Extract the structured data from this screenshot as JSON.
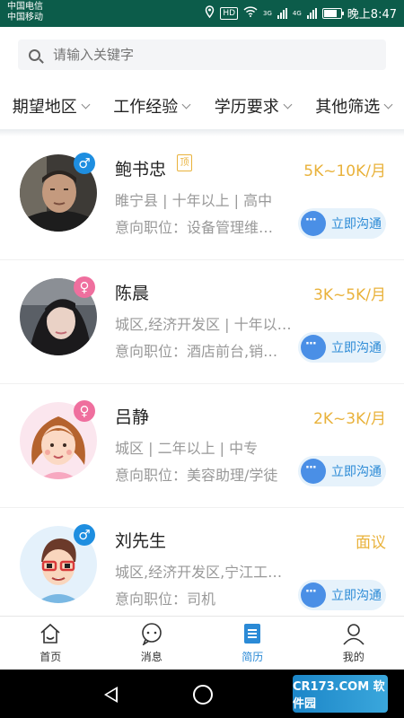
{
  "status_bar": {
    "carrier_1": "中国电信",
    "carrier_2": "中国移动",
    "time": "晚上8:47",
    "hd": "HD",
    "net_1": "3G",
    "net_2": "4G"
  },
  "search": {
    "placeholder": "请输入关键字"
  },
  "filters": [
    {
      "label": "期望地区"
    },
    {
      "label": "工作经验"
    },
    {
      "label": "学历要求"
    },
    {
      "label": "其他筛选"
    }
  ],
  "candidates": [
    {
      "name": "鲍书忠",
      "gender": "male",
      "gender_symbol": "♂",
      "top_badge": "顶",
      "salary": "5K~10K/月",
      "info": "睢宁县 | 十年以上 | 高中",
      "intent": "意向职位：设备管理维…",
      "chat_label": "立即沟通"
    },
    {
      "name": "陈晨",
      "gender": "female",
      "gender_symbol": "♀",
      "top_badge": "",
      "salary": "3K~5K/月",
      "info": "城区,经济开发区 | 十年以…",
      "intent": "意向职位：酒店前台,销…",
      "chat_label": "立即沟通"
    },
    {
      "name": "吕静",
      "gender": "female",
      "gender_symbol": "♀",
      "top_badge": "",
      "salary": "2K~3K/月",
      "info": "城区 | 二年以上 | 中专",
      "intent": "意向职位：美容助理/学徒",
      "chat_label": "立即沟通"
    },
    {
      "name": "刘先生",
      "gender": "male",
      "gender_symbol": "♂",
      "top_badge": "",
      "salary": "面议",
      "info": "城区,经济开发区,宁江工…",
      "intent": "意向职位：司机",
      "chat_label": "立即沟通"
    }
  ],
  "tabbar": {
    "items": [
      {
        "label": "首页",
        "icon": "home-icon",
        "active": false
      },
      {
        "label": "消息",
        "icon": "message-icon",
        "active": false
      },
      {
        "label": "简历",
        "icon": "resume-icon",
        "active": true
      },
      {
        "label": "我的",
        "icon": "profile-icon",
        "active": false
      }
    ]
  },
  "watermark": {
    "text": "CR173.COM 软件园"
  },
  "colors": {
    "accent": "#2b8ad6",
    "salary": "#e9b23b",
    "male": "#1e8ee0",
    "female": "#ef6f9e",
    "status_bar": "#0c5c4a"
  }
}
